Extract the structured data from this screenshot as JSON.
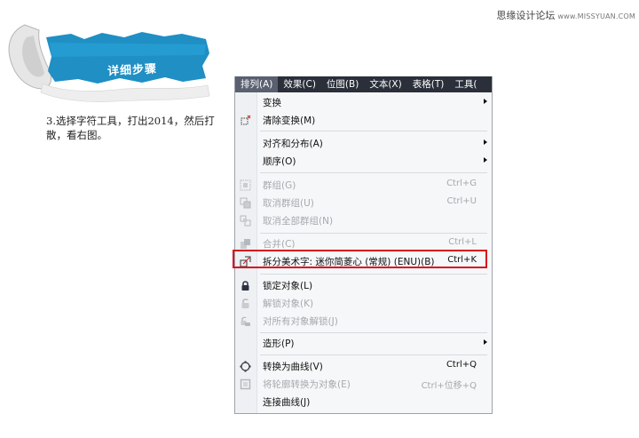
{
  "watermark": {
    "text": "思缘设计论坛",
    "site": "www.MISSYUAN.COM"
  },
  "banner": {
    "title": "详细步骤"
  },
  "step": {
    "text": "3.选择字符工具，打出2014，然后打散，看右图。"
  },
  "menubar": {
    "items": [
      {
        "label": "排列(A)",
        "active": true
      },
      {
        "label": "效果(C)"
      },
      {
        "label": "位图(B)"
      },
      {
        "label": "文本(X)"
      },
      {
        "label": "表格(T)"
      },
      {
        "label": "工具("
      }
    ]
  },
  "menu": {
    "items": [
      {
        "label": "变换",
        "shortcut": "",
        "submenu": true,
        "disabled": false,
        "icon": ""
      },
      {
        "label": "清除变换(M)",
        "shortcut": "",
        "submenu": false,
        "disabled": false,
        "icon": "clear-transform-icon"
      },
      {
        "label": "对齐和分布(A)",
        "shortcut": "",
        "submenu": true,
        "disabled": false,
        "icon": ""
      },
      {
        "label": "顺序(O)",
        "shortcut": "",
        "submenu": true,
        "disabled": false,
        "icon": ""
      },
      {
        "label": "群组(G)",
        "shortcut": "Ctrl+G",
        "submenu": false,
        "disabled": true,
        "icon": "group-icon"
      },
      {
        "label": "取消群组(U)",
        "shortcut": "Ctrl+U",
        "submenu": false,
        "disabled": true,
        "icon": "ungroup-icon"
      },
      {
        "label": "取消全部群组(N)",
        "shortcut": "",
        "submenu": false,
        "disabled": true,
        "icon": "ungroup-all-icon"
      },
      {
        "label": "合并(C)",
        "shortcut": "Ctrl+L",
        "submenu": false,
        "disabled": true,
        "icon": "combine-icon"
      },
      {
        "label": "拆分美术字: 迷你简菱心 (常规) (ENU)(B)",
        "shortcut": "Ctrl+K",
        "submenu": false,
        "disabled": false,
        "icon": "break-apart-icon",
        "highlighted": true
      },
      {
        "label": "锁定对象(L)",
        "shortcut": "",
        "submenu": false,
        "disabled": false,
        "icon": "lock-icon"
      },
      {
        "label": "解锁对象(K)",
        "shortcut": "",
        "submenu": false,
        "disabled": true,
        "icon": "unlock-icon"
      },
      {
        "label": "对所有对象解锁(J)",
        "shortcut": "",
        "submenu": false,
        "disabled": true,
        "icon": "unlock-all-icon"
      },
      {
        "label": "造形(P)",
        "shortcut": "",
        "submenu": true,
        "disabled": false,
        "icon": ""
      },
      {
        "label": "转换为曲线(V)",
        "shortcut": "Ctrl+Q",
        "submenu": false,
        "disabled": false,
        "icon": "convert-to-curves-icon"
      },
      {
        "label": "将轮廓转换为对象(E)",
        "shortcut": "Ctrl+位移+Q",
        "submenu": false,
        "disabled": true,
        "icon": "outline-to-object-icon"
      },
      {
        "label": "连接曲线(J)",
        "shortcut": "",
        "submenu": false,
        "disabled": false,
        "icon": ""
      }
    ]
  },
  "colors": {
    "menubar_bg": "#2a2f3a",
    "highlight_border": "#d8101e",
    "banner_blue": "#1f8fc4",
    "disabled_text": "#a6a9ae"
  }
}
